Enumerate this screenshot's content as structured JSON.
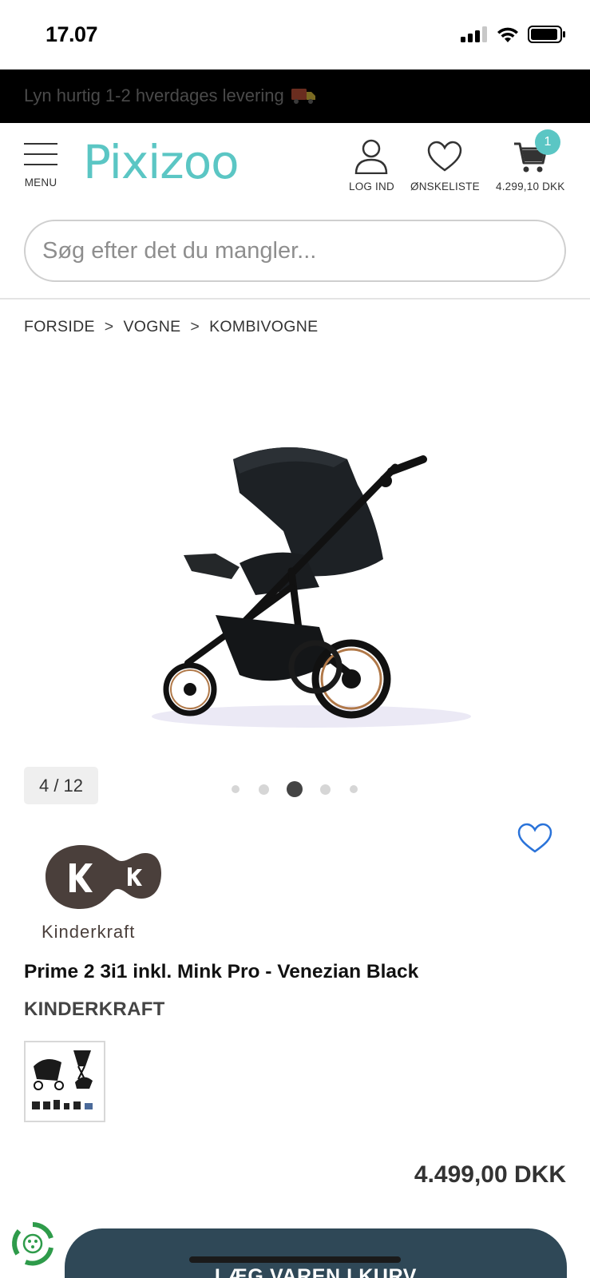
{
  "status_bar": {
    "time": "17.07",
    "icons": [
      "cellular-signal-icon",
      "wifi-icon",
      "battery-icon"
    ]
  },
  "promo": {
    "text": "Lyn hurtig 1-2 hverdages levering",
    "icon": "delivery-truck-icon"
  },
  "header": {
    "menu_label": "MENU",
    "logo_text": "Pixizoo",
    "login_label": "LOG IND",
    "wishlist_label": "ØNSKELISTE",
    "cart_total": "4.299,10 DKK",
    "cart_count": "1",
    "brand_color": "#5bc6c4"
  },
  "search": {
    "placeholder": "Søg efter det du mangler..."
  },
  "breadcrumb": {
    "items": [
      "FORSIDE",
      "VOGNE",
      "KOMBIVOGNE"
    ],
    "separator": ">"
  },
  "gallery": {
    "counter": "4 / 12",
    "active_dot": 2,
    "dot_count": 5
  },
  "product": {
    "brand_logo_text": "Kinderkraft",
    "title": "Prime 2 3i1 inkl. Mink Pro - Venezian Black",
    "brand": "KINDERKRAFT",
    "price": "4.499,00 DKK"
  },
  "actions": {
    "add_to_cart_label": "LÆG VAREN I KURV",
    "button_color": "#2f4857"
  }
}
